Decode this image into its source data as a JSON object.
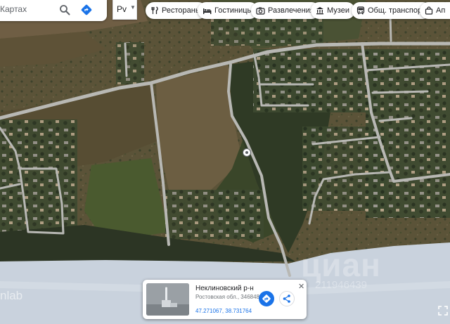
{
  "search": {
    "text": "Картах"
  },
  "layer_selector": {
    "label": "Рv"
  },
  "chips": [
    {
      "label": "Рестораны",
      "icon": "fork-knife-icon"
    },
    {
      "label": "Гостиницы",
      "icon": "bed-icon"
    },
    {
      "label": "Развлечения",
      "icon": "camera-icon"
    },
    {
      "label": "Музеи",
      "icon": "museum-icon"
    },
    {
      "label": "Общ. транспорт",
      "icon": "bus-icon"
    },
    {
      "label": "Ап",
      "icon": "shopping-bag-icon"
    }
  ],
  "place_card": {
    "title": "Неклиновский р-н",
    "address": "Ростовская обл., 346848",
    "coordinates": "47.271067, 38.731764"
  },
  "corner_text": "nlab",
  "watermark": {
    "text": "циан",
    "id": "211946439"
  },
  "colors": {
    "accent": "#1a73e8",
    "water": "#c9d2dd",
    "road": "#b8b8b4",
    "field": "#6b5f40",
    "forest": "#2f3a25"
  }
}
